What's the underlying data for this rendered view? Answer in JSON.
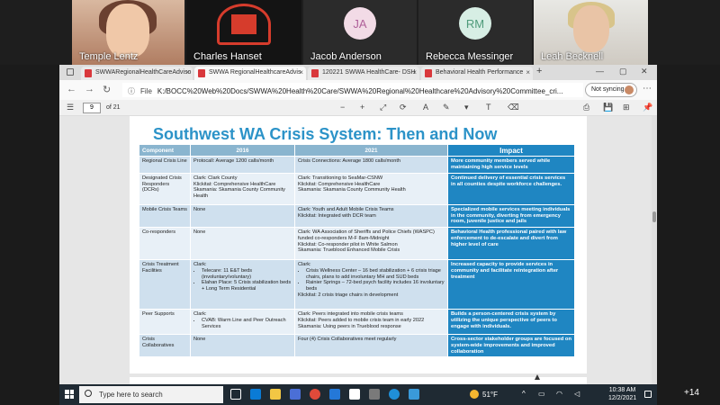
{
  "meeting": {
    "participants": [
      {
        "name": "Temple Lentz"
      },
      {
        "name": "Charles Hanset"
      },
      {
        "name": "Jacob Anderson",
        "initials": "JA"
      },
      {
        "name": "Rebecca Messinger",
        "initials": "RM"
      },
      {
        "name": "Leah Becknell"
      }
    ],
    "overflow_count": "+14"
  },
  "browser": {
    "tabs": [
      {
        "label": "SWWARegionalHealthCareAdviso"
      },
      {
        "label": "SWWA RegionalHealthcareAdvis"
      },
      {
        "label": "120221 SWWA HealthCare- DSH"
      },
      {
        "label": "Behavioral Health Performance"
      }
    ],
    "file_label": "File",
    "url": "K:/BOCC%20Web%20Docs/SWWA%20Health%20Care/SWWA%20Regional%20Healthcare%20Advisory%20Committee_cri...",
    "sync_label": "Not syncing",
    "page_current": "9",
    "page_total_label": "of 21"
  },
  "slide": {
    "title": "Southwest WA Crisis System: Then and Now",
    "headers": [
      "Component",
      "2016",
      "2021",
      "Impact"
    ],
    "rows": [
      {
        "component": "Regional Crisis Line",
        "y2016": [
          "Protocall: Average 1200 calls/month"
        ],
        "y2021": [
          "Crisis Connections: Average 1800 calls/month"
        ],
        "impact": "More community members served while maintaining high service levels"
      },
      {
        "component": "Designated Crisis Responders (DCRs)",
        "y2016": [
          "Clark: Clark County",
          "Klickitat: Comprehensive HealthCare",
          "Skamania: Skamania County Community Health"
        ],
        "y2021": [
          "Clark: Transitioning to SeaMar-CSNW",
          "Klickitat: Comprehensive HealthCare",
          "Skamania: Skamania County Community Health"
        ],
        "impact": "Continued delivery of essential crisis services in all counties despite workforce challenges."
      },
      {
        "component": "Mobile Crisis Teams",
        "y2016": [
          "None"
        ],
        "y2021": [
          "Clark: Youth and Adult Mobile Crisis Teams",
          "Klickitat: Integrated with DCR team"
        ],
        "impact": "Specialized mobile services meeting individuals in the community, diverting from emergency room, juvenile justice and jails"
      },
      {
        "component": "Co-responders",
        "y2016": [
          "None"
        ],
        "y2021": [
          "Clark: WA Association of Sheriffs and Police Chiefs (WASPC) funded co-responders M-F 8am-Midnight",
          "Klickitat: Co-responder pilot in White Salmon",
          "Skamania: Trueblood Enhanced Mobile Crisis"
        ],
        "impact": "Behavioral Health professional paired with law enforcement to de-escalate and divert from higher level of care"
      },
      {
        "component": "Crisis Treatment Facilities",
        "y2016_head": "Clark:",
        "y2016_bullets": [
          "Telecare: 11 E&T beds (involuntary/voluntary)",
          "Elahan Place: 5 Crisis stabilization beds + Long Term Residential"
        ],
        "y2021_head": "Clark:",
        "y2021_bullets": [
          "Crisis Wellness Center – 16 bed stabilization + 6 crisis triage chairs, plans to add involuntary MH and SUD beds",
          "Rainier Springs – 72-bed psych facility includes 16 involuntary beds"
        ],
        "y2021_tail": "Klickitat: 2 crisis triage chairs in development",
        "impact": "Increased capacity to provide services in community and facilitate reintegration after treatment"
      },
      {
        "component": "Peer Supports",
        "y2016_head": "Clark:",
        "y2016_bullets": [
          "CVAB: Warm Line and Peer Outreach Services"
        ],
        "y2021": [
          "Clark: Peers integrated into mobile crisis teams",
          "Klickitat: Peers added to mobile crisis team in early 2022",
          "Skamania: Using peers in Trueblood response"
        ],
        "impact": "Builds a person-centered crisis system by utilizing the unique perspective of peers to engage with individuals."
      },
      {
        "component": "Crisis Collaboratives",
        "y2016": [
          "None"
        ],
        "y2021": [
          "Four (4) Crisis Collaboratives meet regularly"
        ],
        "impact": "Cross-sector stakeholder groups are focused on system-wide improvements and improved collaboration"
      }
    ]
  },
  "taskbar": {
    "search_placeholder": "Type here to search",
    "weather": "51°F",
    "time": "10:38 AM",
    "date": "12/2/2021"
  },
  "colors": {
    "title": "#2c93c8",
    "impact": "#1f86c2",
    "header": "#8ab5cf",
    "row_odd": "#cfe0ee",
    "row_even": "#e8f0f7"
  }
}
